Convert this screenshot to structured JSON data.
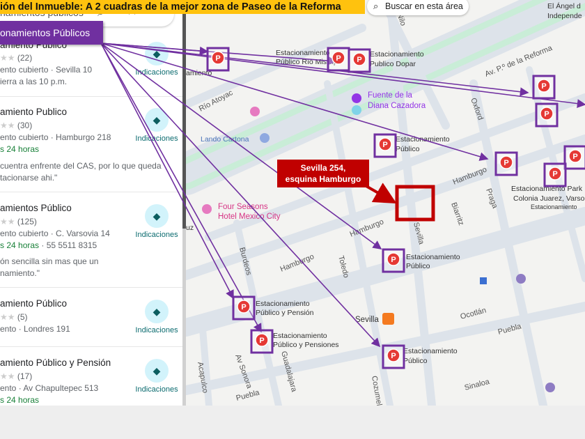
{
  "banner": "ión del Inmueble: A 2 cuadras de la mejor zona de Paseo de la Reforma",
  "tag": "onamientos Públicos",
  "search": {
    "value": "namientos publicos"
  },
  "search_area_button": "Buscar en esta área",
  "callout": {
    "line1": "Sevilla 254,",
    "line2": "esquina Hamburgo"
  },
  "results": [
    {
      "title": "amiento Publico",
      "rating": "(22)",
      "line1": "ento cubierto · Sevilla 10",
      "line2": "ierra a las 10 p.m.",
      "directions": "Indicaciones"
    },
    {
      "title": "amiento Publico",
      "rating": "(30)",
      "line1": "ento cubierto · Hamburgo 218",
      "hours": "s 24 horas",
      "review1": "cuentra enfrente del CAS, por lo que queda",
      "review2": "tacionarse ahi.\"",
      "directions": "Indicaciones"
    },
    {
      "title": "amientos Público",
      "rating": "(125)",
      "line1": "ento cubierto · C. Varsovia 14",
      "hours": "s 24 horas",
      "phone": " · 55 5511 8315",
      "review1": "ón sencilla sin mas que un",
      "review2": "namiento.\"",
      "directions": "Indicaciones"
    },
    {
      "title": "amiento Público",
      "rating": "(5)",
      "line1": "ento · Londres 191",
      "directions": "Indicaciones"
    },
    {
      "title": "amiento Público y Pensión",
      "rating": "(17)",
      "line1": "ento · Av Chapultepec 513",
      "hours": "s 24 horas",
      "directions": "Indicaciones"
    }
  ],
  "map_labels": {
    "angel1": "El Ángel d",
    "angel2": "Independe",
    "reforma": "Av. P.º de la Reforma",
    "nilo": "Nilo",
    "rio_misisipi1": "Estacionamiento",
    "rio_misisipi2": "Público Río Misisipi",
    "dopar1": "Estacionamiento",
    "dopar2": "Publico Dopar",
    "fuente1": "Fuente de la",
    "fuente2": "Diana Cazadora",
    "rio_atoyac": "Río Atoyac",
    "lando": "Lando Cartona",
    "oxford": "Oxford",
    "ep1": "Estacionamiento",
    "ep2": "Público",
    "hamburgo": "Hamburgo",
    "praga": "Praga",
    "biarritz": "Biarritz",
    "park1": "Estacionamiento Park",
    "park2": "Colonia Juarez, Varso",
    "park3": "Estacionamiento",
    "four1": "Four Seasons",
    "four2": "Hotel Mexico City",
    "sevilla": "Sevilla",
    "toledo": "Toledo",
    "burdeos": "Burdeos",
    "e3a": "Estacionamiento",
    "e3b": "Público",
    "e4a": "Estacionamiento",
    "e4b": "Público y Pensión",
    "e5a": "Estacionamiento",
    "e5b": "Público y Pensiones",
    "e6a": "Estacionamiento",
    "e6b": "Público",
    "sevilla_metro": "Sevilla",
    "ocotlan": "Ocotlán",
    "puebla": "Puebla",
    "puebla2": "Puebla",
    "sinaloa": "Sinaloa",
    "acapulco": "Acapulco",
    "sonora": "Av Sonora",
    "guadalajara": "Guadalajara",
    "cozumel": "Cozumel",
    "cuz": "uz",
    "miento": "amiento"
  },
  "colors": {
    "accent": "#7030a0",
    "banner": "#ffc20e",
    "callout": "#c00000"
  }
}
